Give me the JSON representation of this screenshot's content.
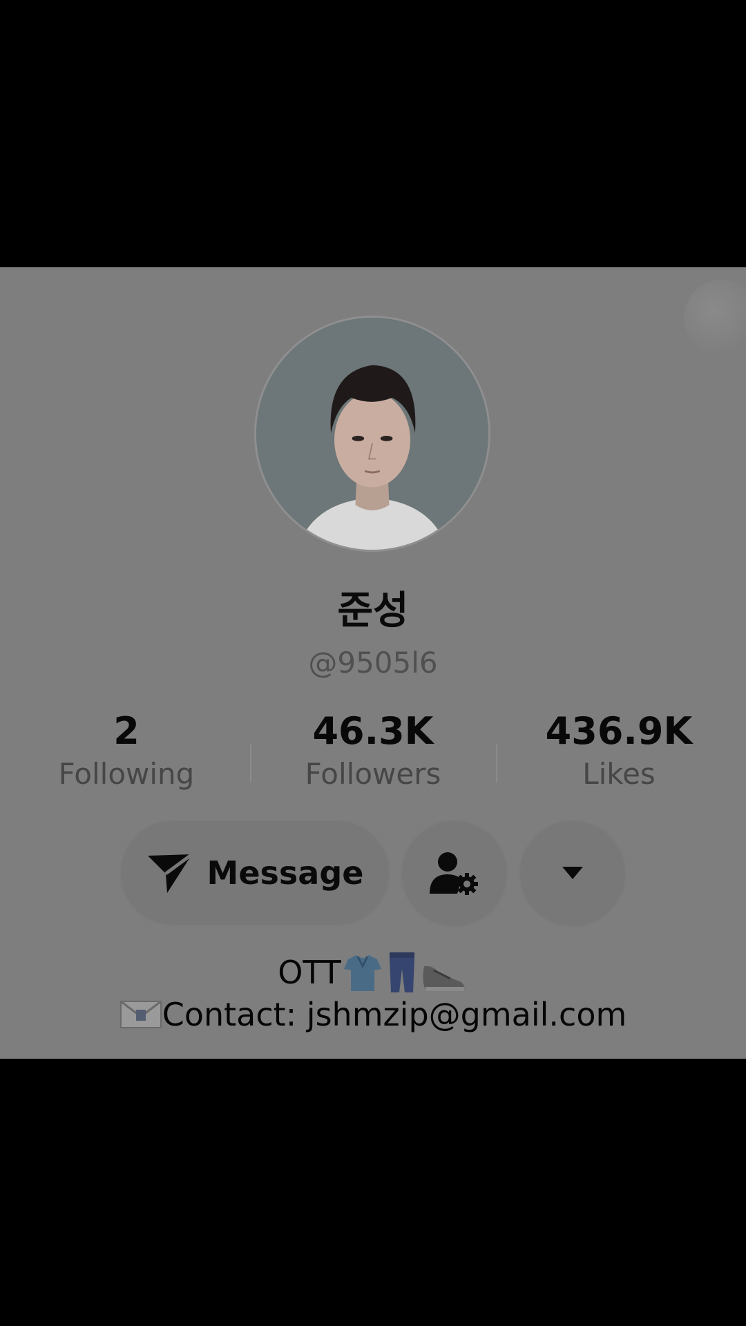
{
  "profile": {
    "display_name": "준성",
    "username": "@9505l6"
  },
  "stats": [
    {
      "value": "2",
      "label": "Following"
    },
    {
      "value": "46.3K",
      "label": "Followers"
    },
    {
      "value": "436.9K",
      "label": "Likes"
    }
  ],
  "actions": {
    "message_label": "Message",
    "message_icon": "send-icon",
    "friend_settings_icon": "user-gear-icon",
    "more_icon": "caret-down-icon"
  },
  "bio": {
    "line1_text": "OTT",
    "line1_emojis": [
      "t-shirt",
      "jeans",
      "sneaker"
    ],
    "line2_emoji": "envelope",
    "line2_text": "Contact: jshmzip@gmail.com"
  },
  "colors": {
    "screen_bg": "#000000",
    "card_bg": "#7e7e7e",
    "button_bg": "#787878",
    "text_primary": "#0a0a0a",
    "text_secondary": "#505050"
  }
}
